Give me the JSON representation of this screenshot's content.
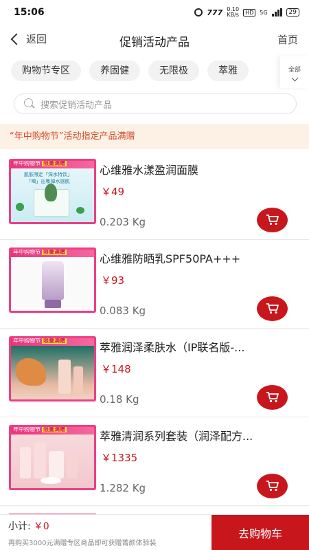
{
  "status_bar": {
    "time": "15:06",
    "network_speed": "0.10\nKB/s",
    "hd_badge": "HD",
    "signal_label": "5G",
    "battery": "29"
  },
  "header": {
    "back_label": "返回",
    "title": "促销活动产品",
    "home_label": "首页"
  },
  "tabs": {
    "items": [
      "购物节专区",
      "养固健",
      "无限极",
      "萃雅"
    ],
    "all_label": "全部"
  },
  "search": {
    "placeholder": "搜索促销活动产品"
  },
  "banner": {
    "text": "“年中购物节”活动指定产品满赠"
  },
  "thumbnail": {
    "header_text": "年中购物节",
    "header_tag": "限量满赠",
    "first_caption_1": "肌肤限定「深水特饮」",
    "first_caption_2": "「喝」出嘭弹水感肌"
  },
  "products": [
    {
      "name": "心维雅水漾盈润面膜",
      "price": "￥49",
      "weight": "0.203 Kg"
    },
    {
      "name": "心维雅防晒乳SPF50PA+++",
      "price": "￥93",
      "weight": "0.083 Kg"
    },
    {
      "name": "萃雅润泽柔肤水（IP联名版-...",
      "price": "￥148",
      "weight": "0.18 Kg"
    },
    {
      "name": "萃雅清润系列套装（润泽配方...",
      "price": "￥1335",
      "weight": "1.282 Kg"
    }
  ],
  "bottom_bar": {
    "subtotal_label": "小计:",
    "subtotal_value": "￥0",
    "promo_note": "再购买3000元满赠专区商品即可获赠菁颜体验装",
    "checkout_label": "去购物车"
  },
  "colors": {
    "accent_red": "#c8161d",
    "banner_bg": "#fdf1e6",
    "banner_text": "#d44b2a",
    "thumb_pink": "#ec3f86"
  },
  "icons": {
    "back": "chevron-left-icon",
    "search": "search-icon",
    "cart": "shopping-cart-icon",
    "expand": "chevron-down-icon"
  }
}
